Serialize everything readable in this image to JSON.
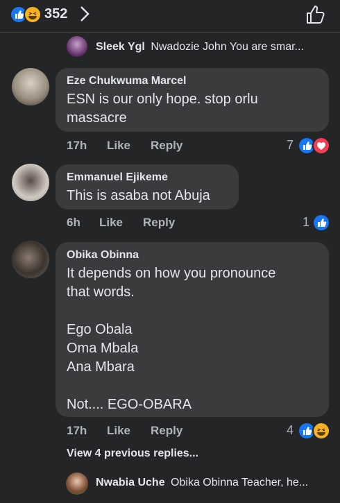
{
  "header": {
    "reaction_count": "352",
    "chevron_icon": "chevron-right-icon",
    "like_icon": "thumbs-up-outline-icon"
  },
  "top_reply": {
    "author": "Sleek Ygl",
    "text": "Nwadozie John You are smar..."
  },
  "comments": [
    {
      "author": "Eze Chukwuma Marcel",
      "text": "ESN is our only hope. stop orlu\nmassacre",
      "time": "17h",
      "like_label": "Like",
      "reply_label": "Reply",
      "reaction_count": "7",
      "reactions": [
        "like",
        "love"
      ]
    },
    {
      "author": "Emmanuel Ejikeme",
      "text": "This is asaba not Abuja",
      "time": "6h",
      "like_label": "Like",
      "reply_label": "Reply",
      "reaction_count": "1",
      "reactions": [
        "like"
      ]
    },
    {
      "author": "Obika Obinna",
      "text": "It depends on how you pronounce\nthat words.\n\nEgo Obala\nOma Mbala\nAna Mbara\n\nNot.... EGO-OBARA",
      "time": "17h",
      "like_label": "Like",
      "reply_label": "Reply",
      "reaction_count": "4",
      "reactions": [
        "like",
        "haha"
      ]
    }
  ],
  "view_previous": "View 4 previous replies...",
  "bottom_reply": {
    "author": "Nwabia Uche",
    "text": "Obika Obinna Teacher, he..."
  },
  "colors": {
    "background": "#242526",
    "bubble": "#3a3b3c",
    "like_blue": "#1877f2",
    "love_red": "#f33e58",
    "haha_yellow": "#f7b125"
  }
}
